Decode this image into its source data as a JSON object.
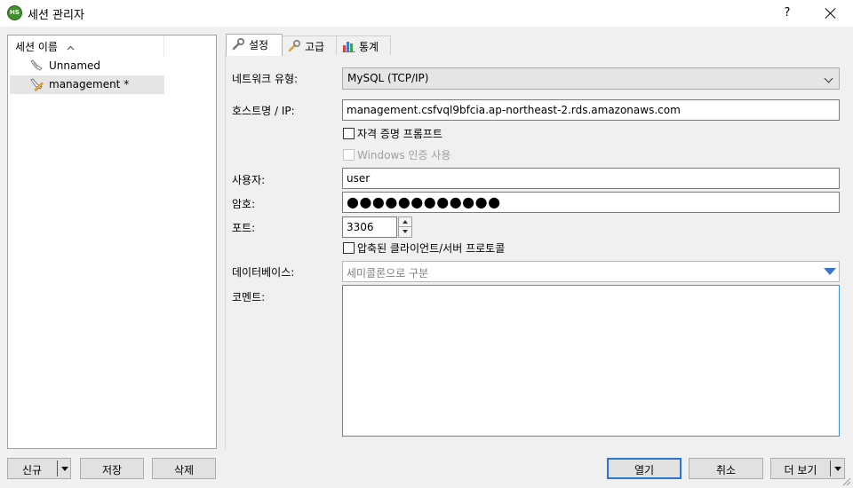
{
  "window": {
    "title": "세션 관리자",
    "help_label": "?"
  },
  "sessions": {
    "column_header": "세션 이름",
    "sort_icon": "chevron-up-icon",
    "items": [
      {
        "label": "Unnamed",
        "icon": "session-icon"
      },
      {
        "label": "management *",
        "icon": "session-edit-icon",
        "selected": true
      }
    ]
  },
  "tabs": [
    {
      "label": "설정",
      "icon": "wrench-icon",
      "active": true
    },
    {
      "label": "고급",
      "icon": "wrench-plus-icon"
    },
    {
      "label": "통계",
      "icon": "bar-chart-icon"
    }
  ],
  "settings": {
    "network_type_label": "네트워크 유형:",
    "network_type_value": "MySQL (TCP/IP)",
    "hostname_label": "호스트명 / IP:",
    "hostname_value": "management.csfvql9bfcia.ap-northeast-2.rds.amazonaws.com",
    "credential_prompt_label": "자격 증명 프롬프트",
    "windows_auth_label": "Windows 인증 사용",
    "user_label": "사용자:",
    "user_value": "user",
    "password_label": "암호:",
    "password_value": "●●●●●●●●●●●●",
    "port_label": "포트:",
    "port_value": "3306",
    "compressed_label": "압축된 클라이언트/서버 프로토콜",
    "database_label": "데이터베이스:",
    "database_placeholder": "세미콜론으로 구분",
    "comment_label": "코멘트:",
    "comment_value": ""
  },
  "buttons": {
    "new": "신규",
    "save": "저장",
    "delete": "삭제",
    "open": "열기",
    "cancel": "취소",
    "more": "더 보기"
  }
}
